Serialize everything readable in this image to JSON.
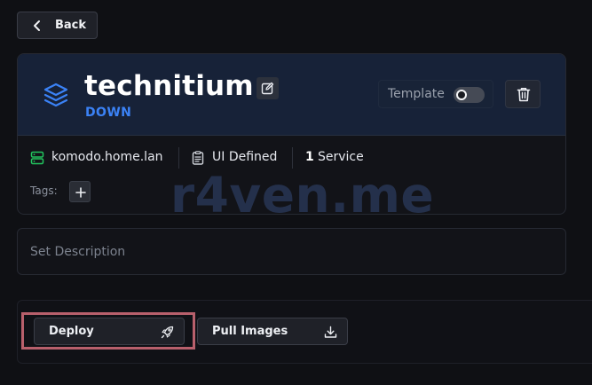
{
  "back_button": {
    "label": "Back",
    "icon": "chevron-left-icon"
  },
  "stack": {
    "name": "technitium",
    "status": "DOWN",
    "status_color": "#3b82f6",
    "template_label": "Template",
    "template_enabled": false
  },
  "info": {
    "server": "komodo.home.lan",
    "source": "UI Defined",
    "service_count": "1",
    "service_label": "Service"
  },
  "tags": {
    "label": "Tags:"
  },
  "description": {
    "placeholder": "Set Description"
  },
  "actions": {
    "deploy_label": "Deploy",
    "pull_label": "Pull Images"
  },
  "watermark": "r4ven.me",
  "colors": {
    "accent": "#3b82f6",
    "server_ok": "#22c55e",
    "header_bg": "#172238",
    "highlight": "#b8606c"
  }
}
